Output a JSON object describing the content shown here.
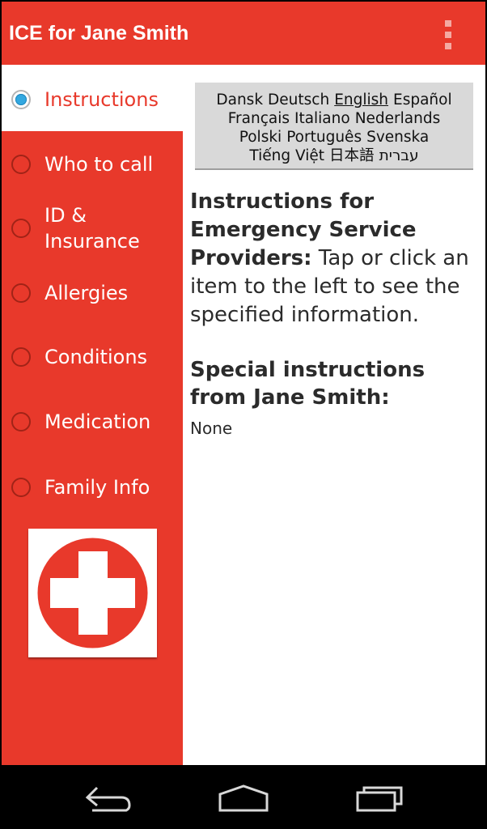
{
  "action_bar": {
    "title": "ICE for Jane Smith",
    "overflow_icon": "overflow-menu-icon",
    "color": "#e8392b"
  },
  "sidebar": {
    "items": [
      {
        "label": "Instructions",
        "selected": true
      },
      {
        "label": "Who to call",
        "selected": false
      },
      {
        "label": "ID &",
        "label2": "Insurance",
        "selected": false
      },
      {
        "label": "Allergies",
        "selected": false
      },
      {
        "label": "Conditions",
        "selected": false
      },
      {
        "label": "Medication",
        "selected": false
      },
      {
        "label": "Family Info",
        "selected": false
      }
    ],
    "logo_icon": "red-cross-icon"
  },
  "languages": {
    "rows": [
      [
        "Dansk",
        "Deutsch",
        "English",
        "Español"
      ],
      [
        "Français",
        "Italiano",
        "Nederlands"
      ],
      [
        "Polski",
        "Português",
        "Svenska"
      ],
      [
        "Tiếng Việt",
        "日本語",
        "עברית"
      ]
    ],
    "current": "English"
  },
  "content": {
    "instructions_bold": "Instructions for Emergency Service Providers:",
    "instructions_text": " Tap or click an item to the left to see the specified information.",
    "special_heading": "Special instructions from Jane Smith:",
    "special_value": "None"
  },
  "system_nav": {
    "back_icon": "back-icon",
    "home_icon": "home-icon",
    "recents_icon": "recent-apps-icon"
  }
}
